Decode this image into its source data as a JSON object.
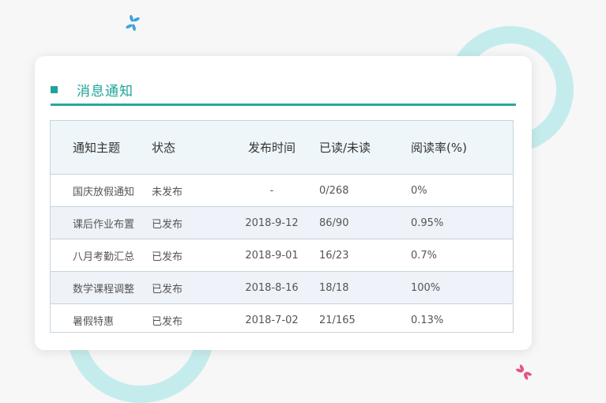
{
  "card": {
    "title": "消息通知",
    "icon": "square-bullet-icon"
  },
  "table": {
    "headers": {
      "topic": "通知主题",
      "status": "状态",
      "date": "发布时间",
      "read": "已读/未读",
      "rate": "阅读率(%)"
    },
    "rows": [
      {
        "topic": "国庆放假通知",
        "status": "未发布",
        "date": "-",
        "read": "0/268",
        "rate": "0%"
      },
      {
        "topic": "课后作业布置",
        "status": "已发布",
        "date": "2018-9-12",
        "read": "86/90",
        "rate": "0.95%"
      },
      {
        "topic": "八月考勤汇总",
        "status": "已发布",
        "date": "2018-9-01",
        "read": "16/23",
        "rate": "0.7%"
      },
      {
        "topic": "数学课程调整",
        "status": "已发布",
        "date": "2018-8-16",
        "read": "18/18",
        "rate": "100%"
      },
      {
        "topic": "暑假特惠",
        "status": "已发布",
        "date": "2018-7-02",
        "read": "21/165",
        "rate": "0.13%"
      }
    ]
  },
  "colors": {
    "accent": "#1fa398",
    "ring": "#c5ecec",
    "sparkle_blue": "#3da2dc",
    "sparkle_yellow": "#f2c23a",
    "sparkle_pink": "#e05584"
  }
}
